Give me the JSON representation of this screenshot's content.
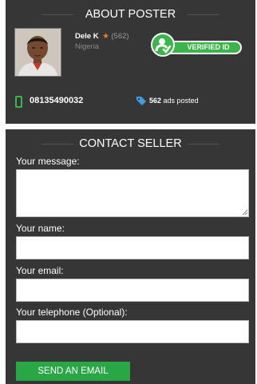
{
  "about": {
    "heading": "ABOUT POSTER",
    "name": "Dele K",
    "rating_icon": "star-icon",
    "rating_count": "(562)",
    "location": "Nigeria",
    "verified_label": "VERIFIED ID",
    "phone": "08135490032",
    "ads_count": "562",
    "ads_suffix": "ads posted"
  },
  "contact": {
    "heading": "CONTACT SELLER",
    "message_label": "Your message:",
    "name_label": "Your name:",
    "email_label": "Your email:",
    "telephone_label": "Your telephone (Optional):",
    "message_value": "",
    "name_value": "",
    "email_value": "",
    "telephone_value": "",
    "send_label": "SEND AN EMAIL"
  },
  "colors": {
    "panel": "#363636",
    "accent_green": "#3bb54a",
    "button_green": "#29a745",
    "star_orange": "#f58220",
    "tag_blue": "#3aa0e0"
  }
}
